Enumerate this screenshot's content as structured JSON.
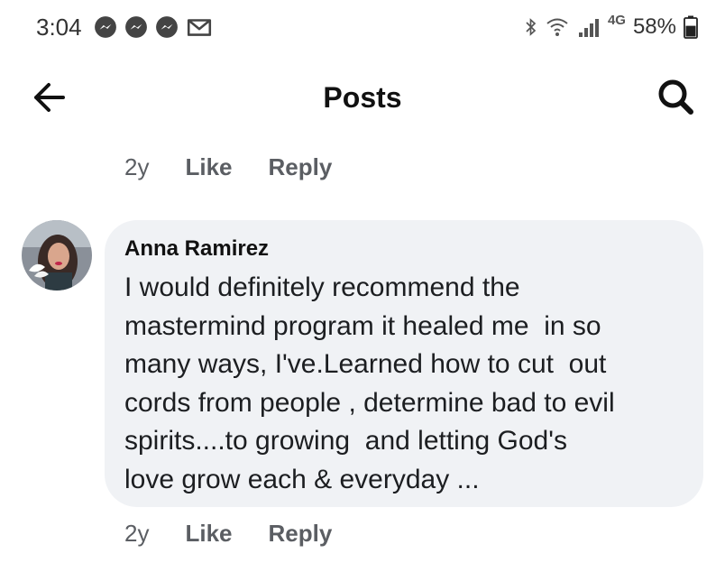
{
  "status_bar": {
    "time": "3:04",
    "notification_icons": [
      "messenger-icon",
      "messenger-icon",
      "messenger-icon",
      "gmail-icon"
    ],
    "network_label": "4G",
    "battery_text": "58%",
    "battery_level": 0.58
  },
  "header": {
    "title": "Posts",
    "back_icon": "arrow-left-icon",
    "search_icon": "search-icon"
  },
  "previous_comment_actions": {
    "age": "2y",
    "like": "Like",
    "reply": "Reply"
  },
  "comment": {
    "author": "Anna Ramirez",
    "text": "I would definitely recommend the\nmastermind program it healed me  in so\nmany ways, I've.Learned how to cut  out\ncords from people , determine bad to evil\nspirits....to growing  and letting God's\nlove grow each & everyday ...",
    "actions": {
      "age": "2y",
      "like": "Like",
      "reply": "Reply"
    }
  },
  "colors": {
    "bubble_bg": "#f0f2f5",
    "meta_text": "#5b5e63",
    "text": "#1c1e21"
  }
}
